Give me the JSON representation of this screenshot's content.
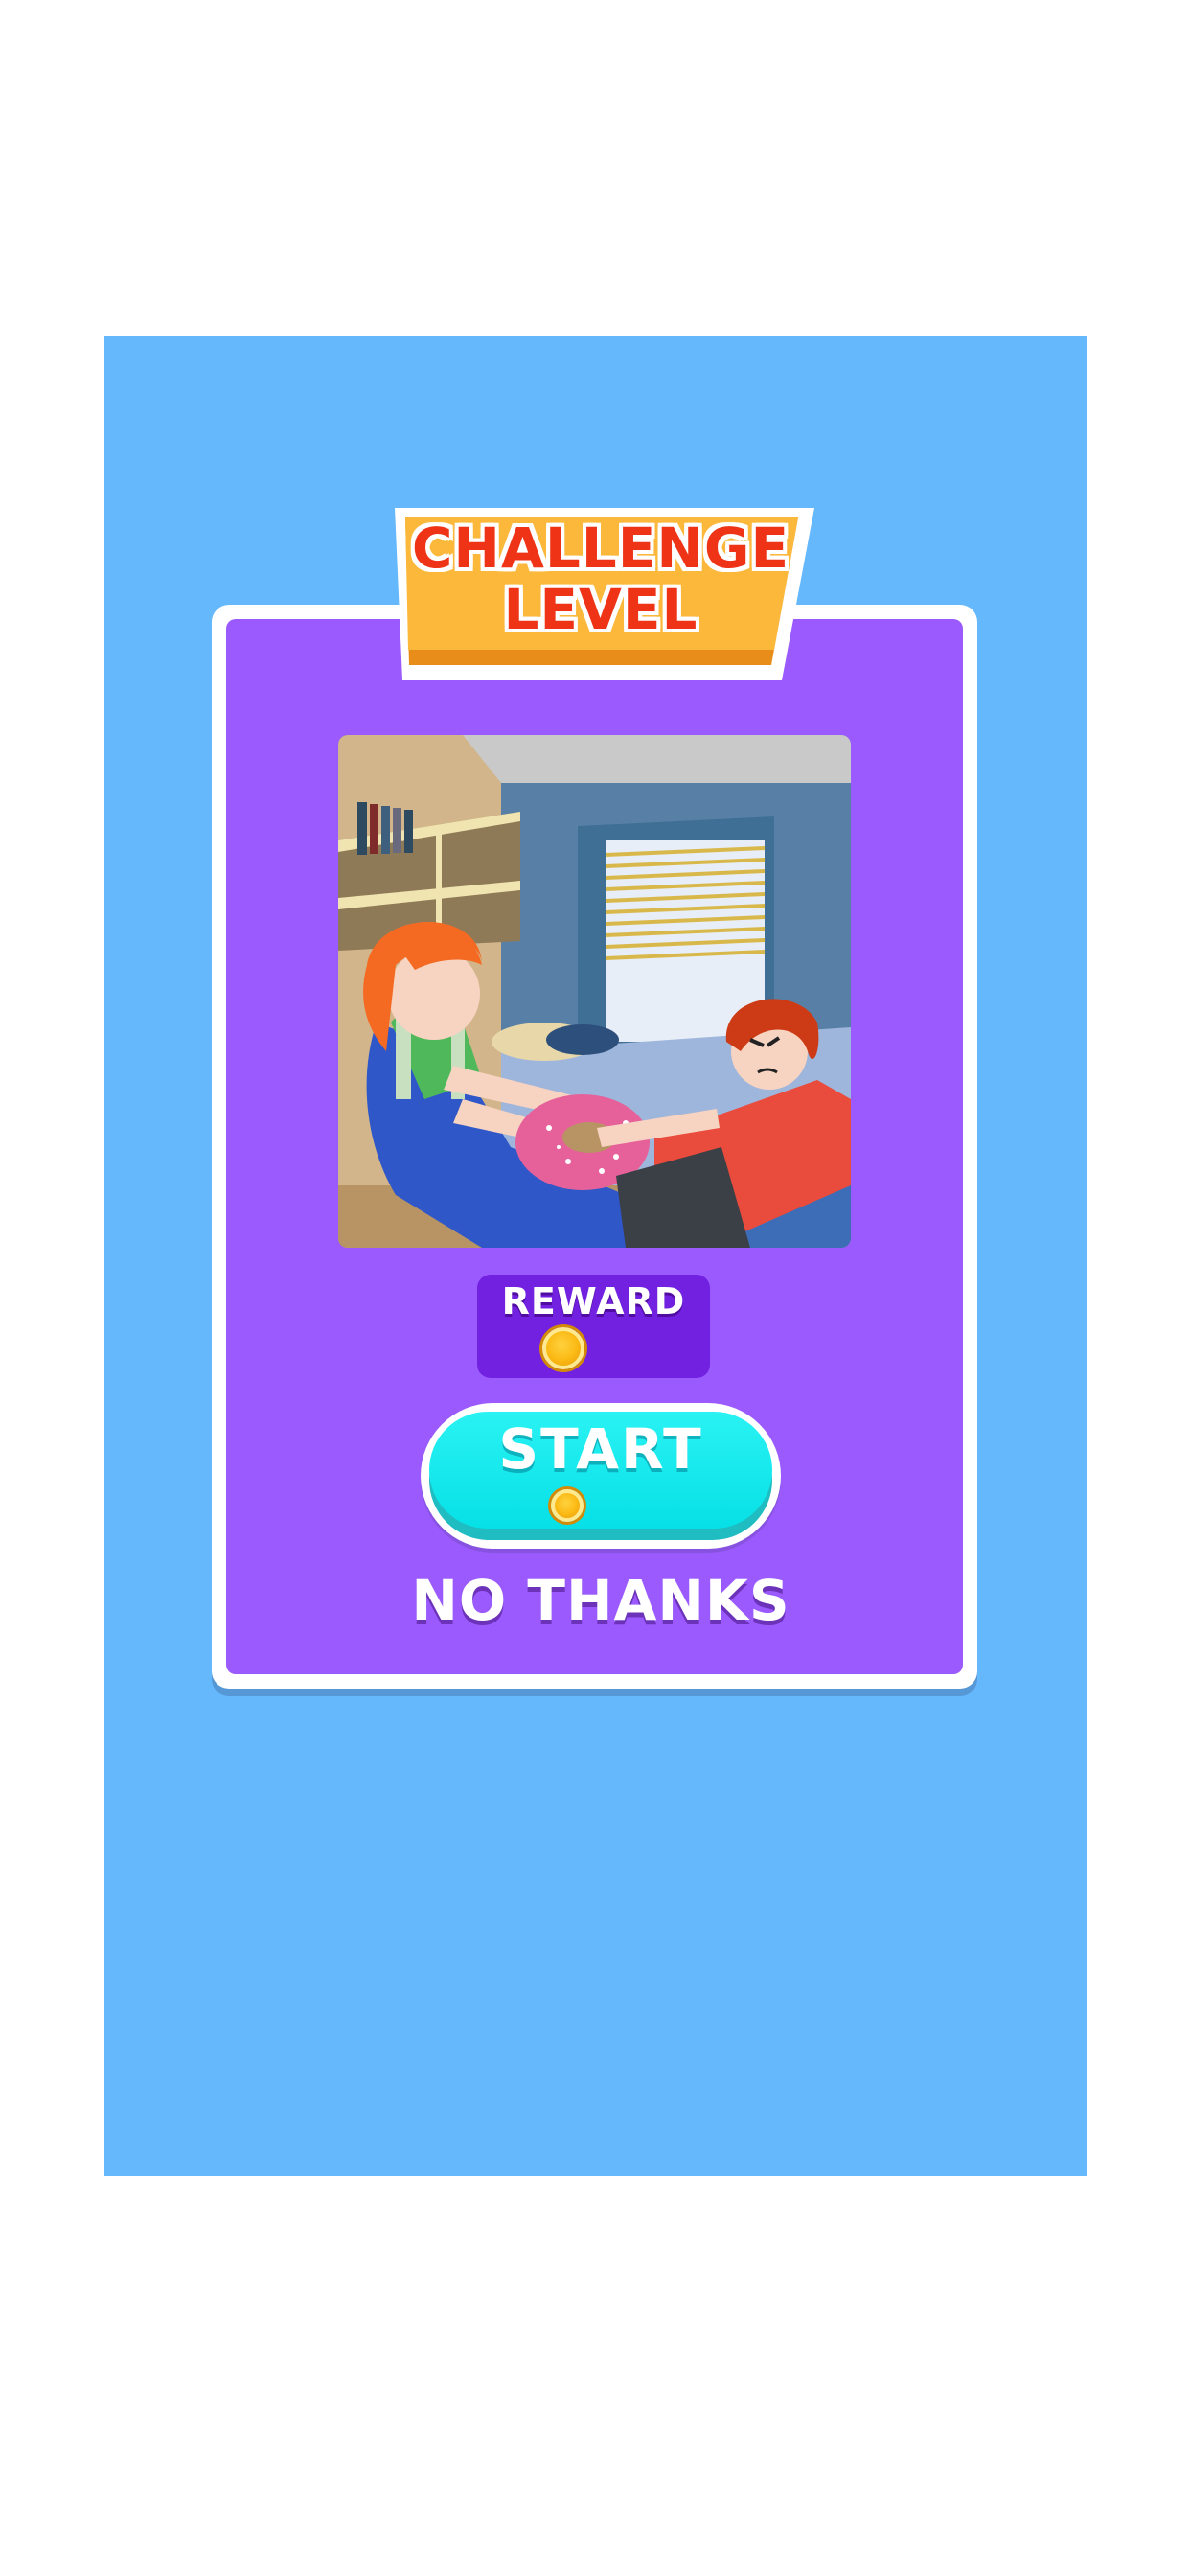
{
  "banner": {
    "line1": "CHALLENGE",
    "line2": "LEVEL"
  },
  "reward": {
    "label": "REWARD",
    "icon": "coin-icon"
  },
  "start_button": {
    "label": "START",
    "icon": "coin-icon"
  },
  "no_thanks": {
    "label": "NO THANKS"
  },
  "colors": {
    "background": "#65b8fc",
    "card": "#9b5afe",
    "reward_box": "#7121df",
    "start_button": "#06e0e6",
    "banner_fill": "#fbb83a",
    "banner_text": "#ee3316"
  }
}
